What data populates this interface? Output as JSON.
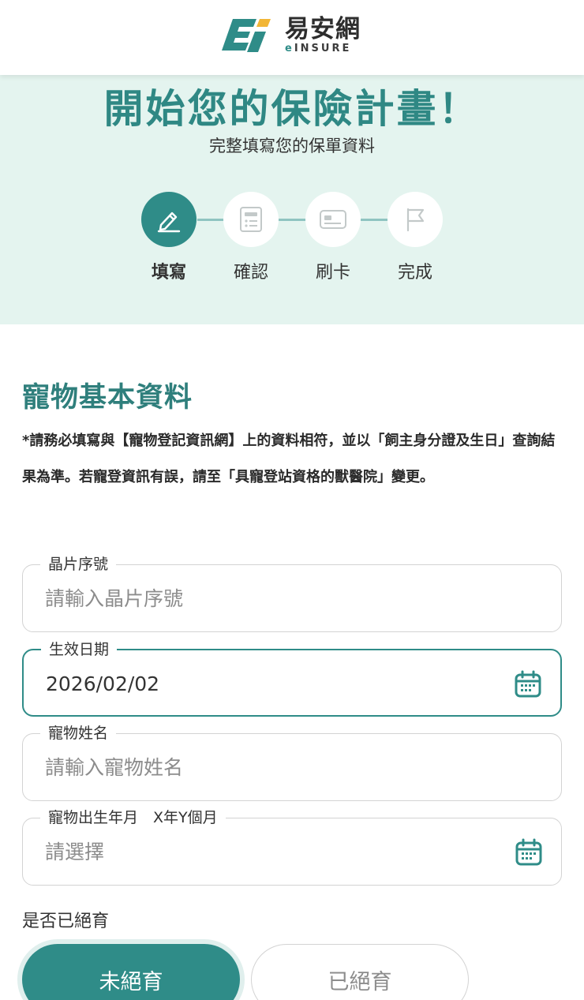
{
  "header": {
    "logo_name": "易安網",
    "logo_sub_e": "e",
    "logo_sub_rest": "INSURE",
    "brand_colors": {
      "teal": "#2f8c88",
      "yellow": "#f2b636"
    }
  },
  "hero": {
    "title": "開始您的保險計畫！",
    "subtitle": "完整填寫您的保單資料"
  },
  "steps": [
    {
      "label": "填寫",
      "icon": "pencil-icon",
      "active": true
    },
    {
      "label": "確認",
      "icon": "checklist-icon",
      "active": false
    },
    {
      "label": "刷卡",
      "icon": "credit-card-icon",
      "active": false
    },
    {
      "label": "完成",
      "icon": "flag-icon",
      "active": false
    }
  ],
  "section": {
    "title": "寵物基本資料",
    "note": "*請務必填寫與【寵物登記資訊網】上的資料相符，並以「飼主身分證及生日」查詢結果為準。若寵登資訊有誤，請至「具寵登站資格的獸醫院」變更。"
  },
  "fields": {
    "chip": {
      "label": "晶片序號",
      "placeholder": "請輸入晶片序號"
    },
    "effective_date": {
      "label": "生效日期",
      "value": "2026/02/02",
      "icon": "calendar-icon"
    },
    "pet_name": {
      "label": "寵物姓名",
      "placeholder": "請輸入寵物姓名"
    },
    "birth": {
      "label": "寵物出生年月　X年Y個月",
      "placeholder": "請選擇",
      "icon": "calendar-icon"
    }
  },
  "neutered": {
    "question": "是否已絕育",
    "option_no": "未絕育",
    "option_yes": "已絕育",
    "selected": "未絕育"
  }
}
